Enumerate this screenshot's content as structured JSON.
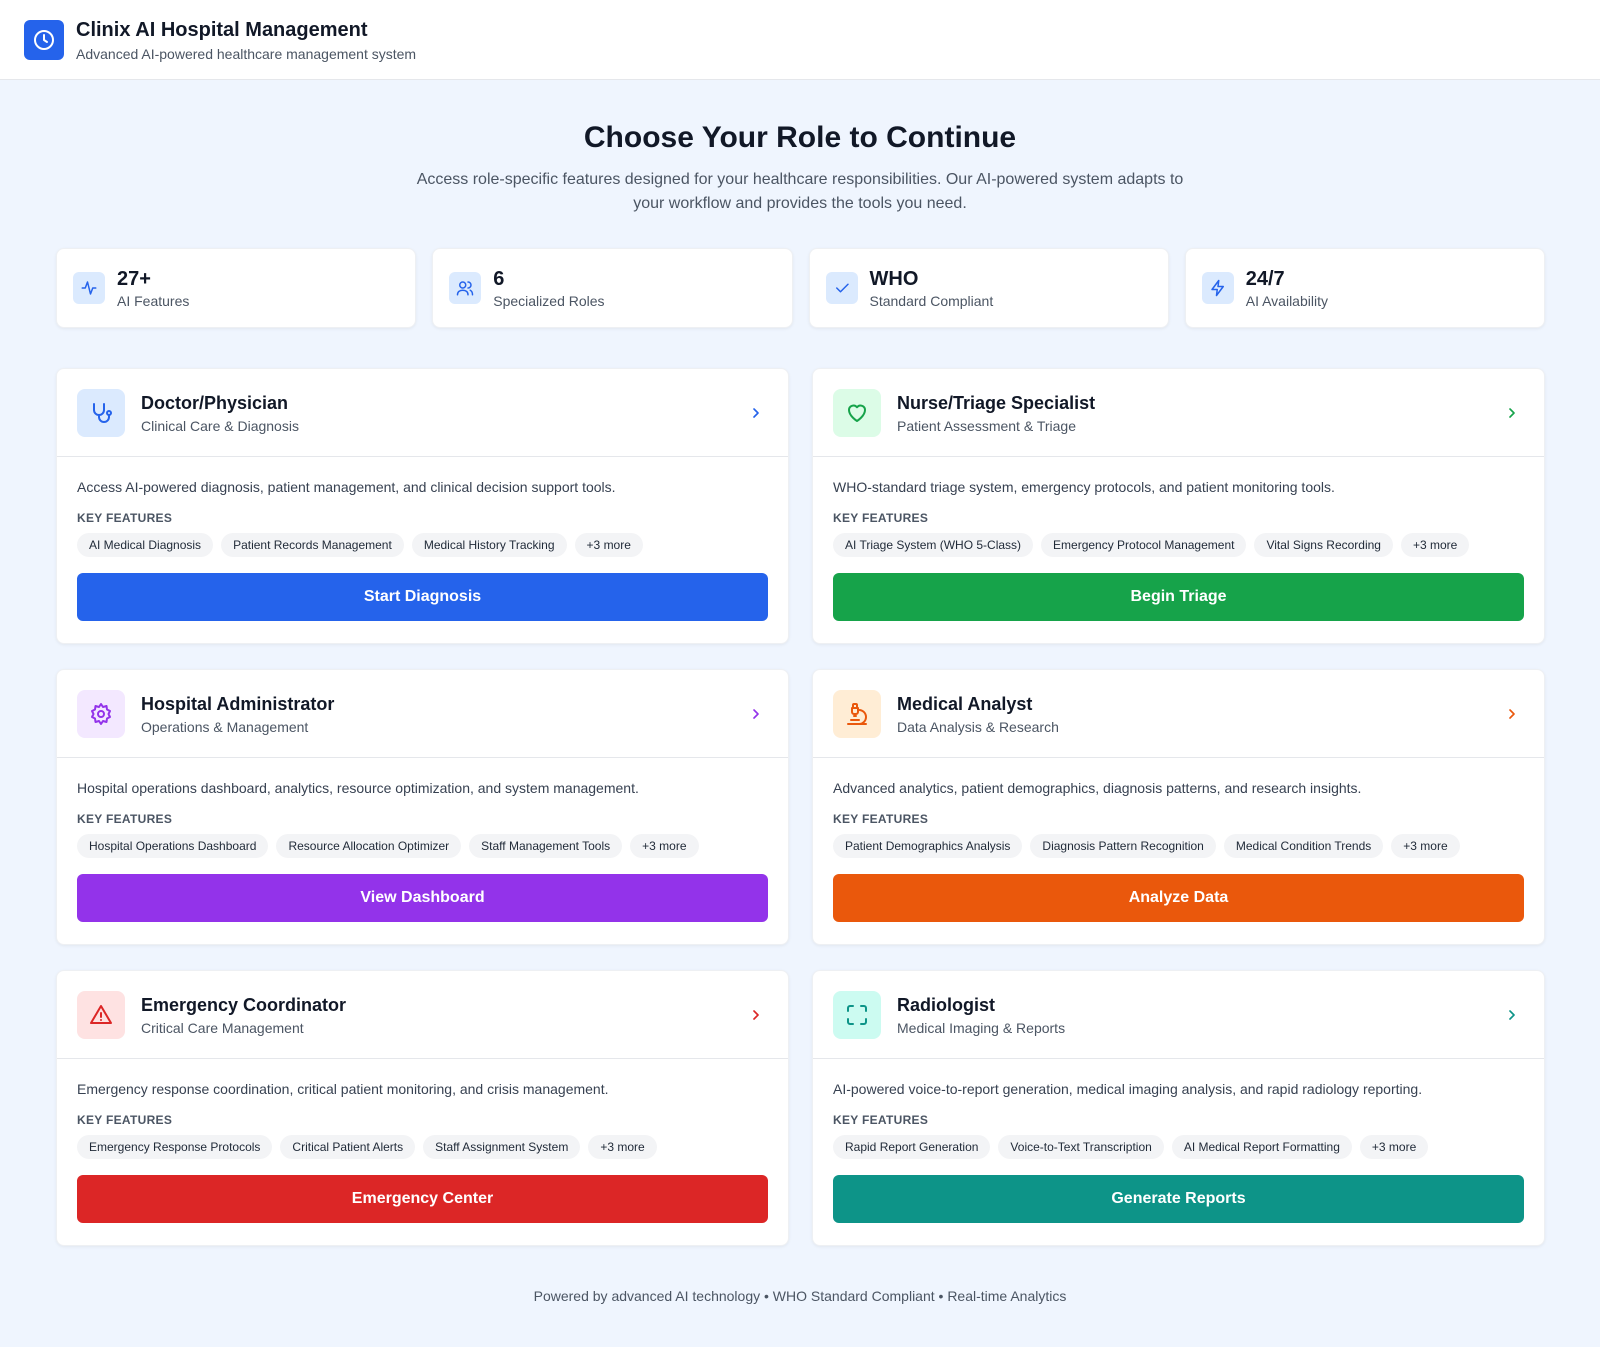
{
  "header": {
    "title": "Clinix AI Hospital Management",
    "subtitle": "Advanced AI-powered healthcare management system",
    "logo_icon": "clock-icon",
    "accent": "#2563eb"
  },
  "hero": {
    "title": "Choose Your Role to Continue",
    "description": "Access role-specific features designed for your healthcare responsibilities. Our AI-powered system adapts to your workflow and provides the tools you need."
  },
  "stats": [
    {
      "value": "27+",
      "label": "AI Features",
      "icon": "activity-icon"
    },
    {
      "value": "6",
      "label": "Specialized Roles",
      "icon": "users-icon"
    },
    {
      "value": "WHO",
      "label": "Standard Compliant",
      "icon": "check-icon"
    },
    {
      "value": "24/7",
      "label": "AI Availability",
      "icon": "lightning-icon"
    }
  ],
  "key_features_label": "KEY FEATURES",
  "roles": [
    {
      "title": "Doctor/Physician",
      "subtitle": "Clinical Care & Diagnosis",
      "description": "Access AI-powered diagnosis, patient management, and clinical decision support tools.",
      "features": [
        "AI Medical Diagnosis",
        "Patient Records Management",
        "Medical History Tracking",
        "+3 more"
      ],
      "button": "Start Diagnosis",
      "icon": "stethoscope-icon",
      "color": "#2563eb",
      "icon_bg": "#dbeafe"
    },
    {
      "title": "Nurse/Triage Specialist",
      "subtitle": "Patient Assessment & Triage",
      "description": "WHO-standard triage system, emergency protocols, and patient monitoring tools.",
      "features": [
        "AI Triage System (WHO 5-Class)",
        "Emergency Protocol Management",
        "Vital Signs Recording",
        "+3 more"
      ],
      "button": "Begin Triage",
      "icon": "heart-icon",
      "color": "#16a34a",
      "icon_bg": "#dcfce7"
    },
    {
      "title": "Hospital Administrator",
      "subtitle": "Operations & Management",
      "description": "Hospital operations dashboard, analytics, resource optimization, and system management.",
      "features": [
        "Hospital Operations Dashboard",
        "Resource Allocation Optimizer",
        "Staff Management Tools",
        "+3 more"
      ],
      "button": "View Dashboard",
      "icon": "gear-icon",
      "color": "#9333ea",
      "icon_bg": "#f3e8ff"
    },
    {
      "title": "Medical Analyst",
      "subtitle": "Data Analysis & Research",
      "description": "Advanced analytics, patient demographics, diagnosis patterns, and research insights.",
      "features": [
        "Patient Demographics Analysis",
        "Diagnosis Pattern Recognition",
        "Medical Condition Trends",
        "+3 more"
      ],
      "button": "Analyze Data",
      "icon": "microscope-icon",
      "color": "#ea580c",
      "icon_bg": "#ffedd5"
    },
    {
      "title": "Emergency Coordinator",
      "subtitle": "Critical Care Management",
      "description": "Emergency response coordination, critical patient monitoring, and crisis management.",
      "features": [
        "Emergency Response Protocols",
        "Critical Patient Alerts",
        "Staff Assignment System",
        "+3 more"
      ],
      "button": "Emergency Center",
      "icon": "warning-icon",
      "color": "#dc2626",
      "icon_bg": "#fee2e2"
    },
    {
      "title": "Radiologist",
      "subtitle": "Medical Imaging & Reports",
      "description": "AI-powered voice-to-report generation, medical imaging analysis, and rapid radiology reporting.",
      "features": [
        "Rapid Report Generation",
        "Voice-to-Text Transcription",
        "AI Medical Report Formatting",
        "+3 more"
      ],
      "button": "Generate Reports",
      "icon": "scan-icon",
      "color": "#0d9488",
      "icon_bg": "#ccfbf1"
    }
  ],
  "footer": "Powered by advanced AI technology • WHO Standard Compliant • Real-time Analytics"
}
